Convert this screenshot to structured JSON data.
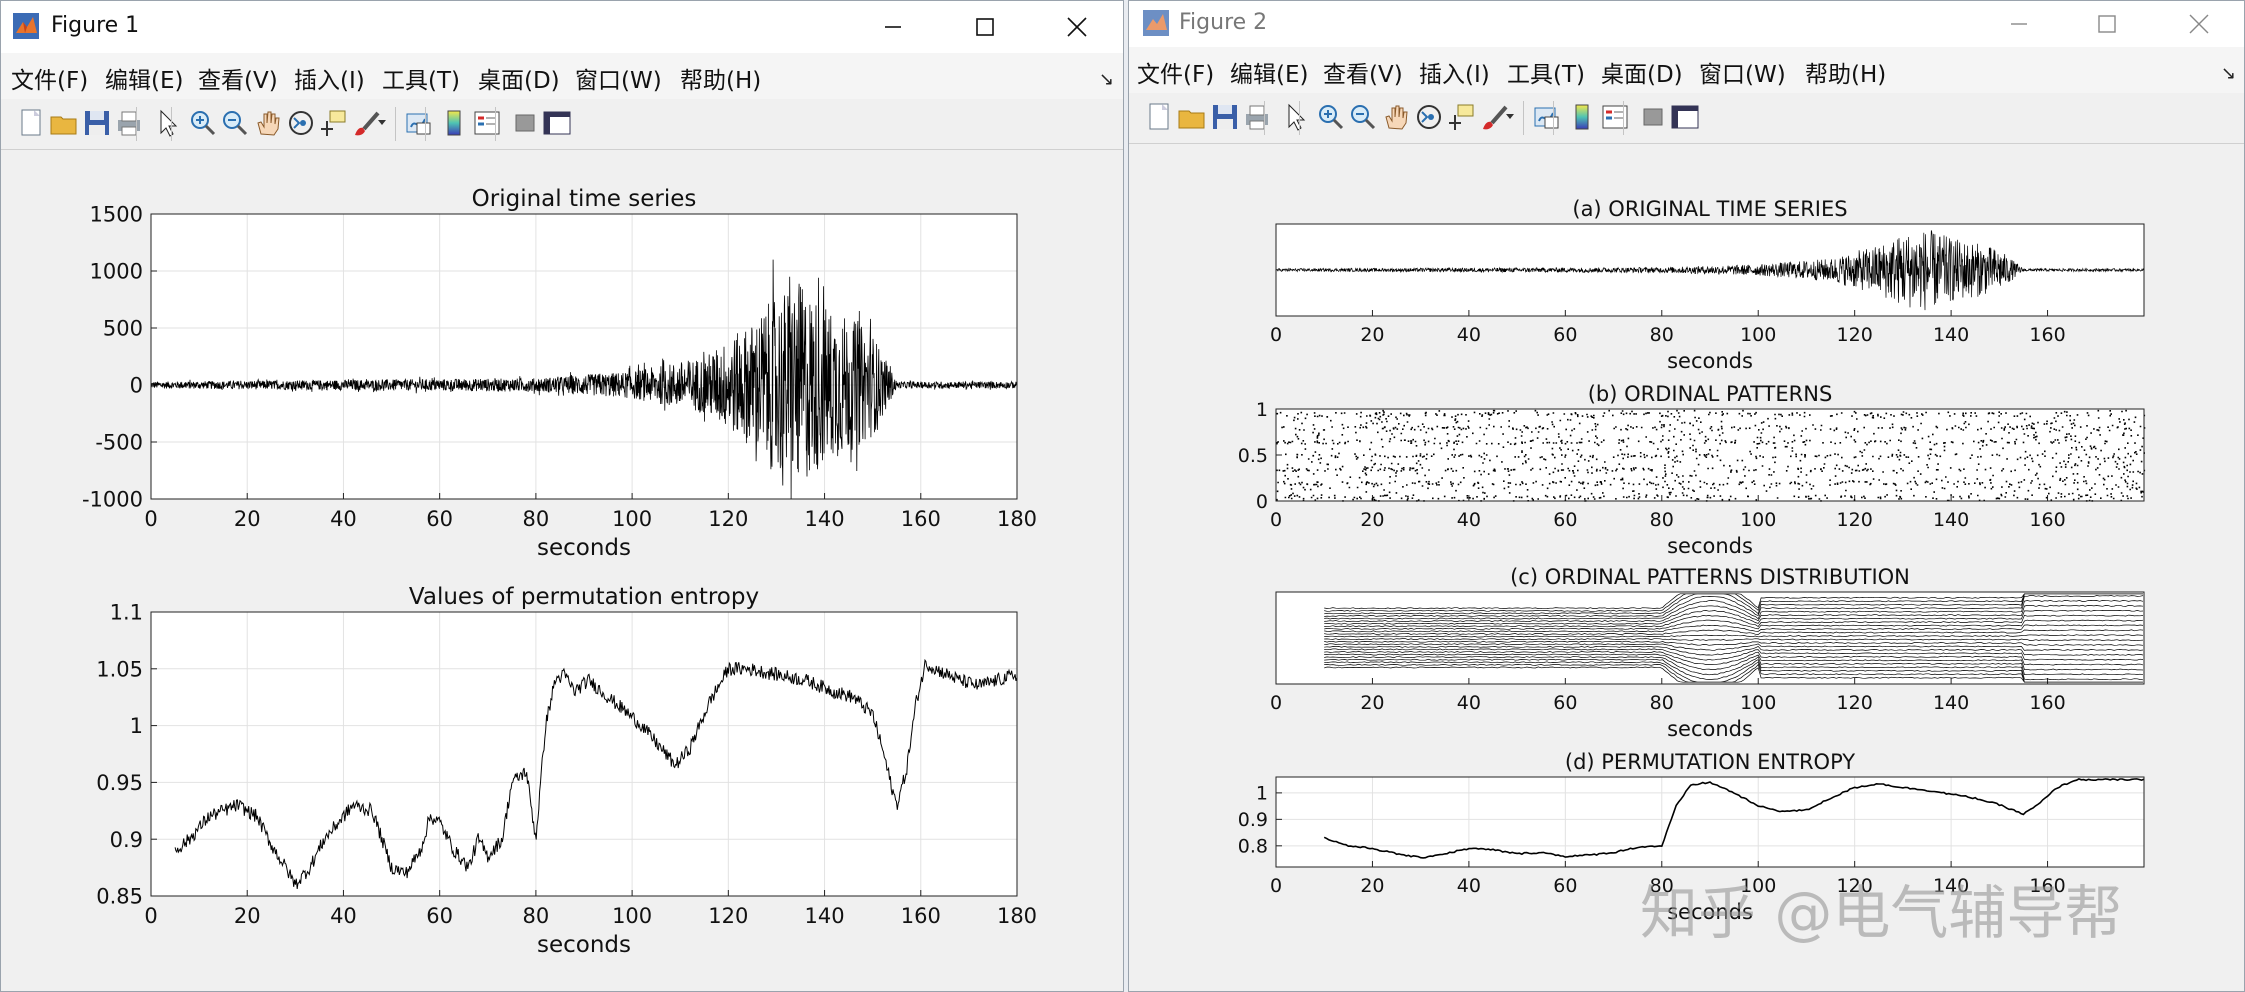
{
  "figure1": {
    "title": "Figure 1",
    "menus": [
      "文件(F)",
      "编辑(E)",
      "查看(V)",
      "插入(I)",
      "工具(T)",
      "桌面(D)",
      "窗口(W)",
      "帮助(H)"
    ],
    "dock_glyph": "↘",
    "minimize_glyph": "─",
    "maximize_glyph": "☐",
    "close_glyph": "✕",
    "axes_top": {
      "title": "Original time series",
      "xlabel": "seconds",
      "xticks": [
        "0",
        "20",
        "40",
        "60",
        "80",
        "100",
        "120",
        "140",
        "160",
        "180"
      ],
      "yticks": [
        "1500",
        "1000",
        "500",
        "0",
        "-500",
        "-1000"
      ]
    },
    "axes_bottom": {
      "title": "Values of permutation entropy",
      "xlabel": "seconds",
      "xticks": [
        "0",
        "20",
        "40",
        "60",
        "80",
        "100",
        "120",
        "140",
        "160",
        "180"
      ],
      "yticks": [
        "1.1",
        "1.05",
        "1",
        "0.95",
        "0.9",
        "0.85"
      ]
    }
  },
  "figure2": {
    "title": "Figure 2",
    "menus": [
      "文件(F)",
      "编辑(E)",
      "查看(V)",
      "插入(I)",
      "工具(T)",
      "桌面(D)",
      "窗口(W)",
      "帮助(H)"
    ],
    "dock_glyph": "↘",
    "minimize_glyph": "─",
    "maximize_glyph": "☐",
    "close_glyph": "✕",
    "panel_a": {
      "title": "(a) ORIGINAL TIME SERIES",
      "xlabel": "seconds",
      "xticks": [
        "0",
        "20",
        "40",
        "60",
        "80",
        "100",
        "120",
        "140",
        "160"
      ]
    },
    "panel_b": {
      "title": "(b) ORDINAL PATTERNS",
      "xlabel": "seconds",
      "xticks": [
        "0",
        "20",
        "40",
        "60",
        "80",
        "100",
        "120",
        "140",
        "160"
      ],
      "yticks": [
        "1",
        "0.5",
        "0"
      ]
    },
    "panel_c": {
      "title": "(c) ORDINAL PATTERNS DISTRIBUTION",
      "xlabel": "seconds",
      "xticks": [
        "0",
        "20",
        "40",
        "60",
        "80",
        "100",
        "120",
        "140",
        "160"
      ]
    },
    "panel_d": {
      "title": "(d) PERMUTATION ENTROPY",
      "xlabel": "seconds",
      "xticks": [
        "0",
        "20",
        "40",
        "60",
        "80",
        "100",
        "120",
        "140",
        "160"
      ],
      "yticks": [
        "1",
        "0.9",
        "0.8"
      ]
    }
  },
  "toolbar_icons": [
    "new-figure-icon",
    "open-file-icon",
    "save-icon",
    "print-icon",
    "pointer-icon",
    "zoom-in-icon",
    "zoom-out-icon",
    "pan-hand-icon",
    "rotate-3d-icon",
    "data-cursor-icon",
    "brush-icon",
    "brush-dropdown-icon",
    "link-plot-icon",
    "colorbar-icon",
    "legend-icon",
    "hide-plot-tools-icon",
    "show-plot-tools-icon"
  ],
  "watermark": "知乎 @电气辅导帮",
  "chart_data": [
    {
      "type": "line",
      "title": "Original time series",
      "xlabel": "seconds",
      "ylabel": "",
      "xlim": [
        0,
        180
      ],
      "ylim": [
        -1000,
        1500
      ],
      "grid": true,
      "series": [
        {
          "x": [
            0,
            80,
            100,
            115,
            125,
            130,
            135,
            140,
            145,
            150,
            155,
            160,
            180
          ],
          "amplitude": [
            30,
            60,
            120,
            250,
            550,
            800,
            900,
            700,
            600,
            450,
            30,
            30,
            30
          ]
        }
      ]
    },
    {
      "type": "line",
      "title": "Values of permutation entropy",
      "xlabel": "seconds",
      "ylabel": "",
      "xlim": [
        0,
        180
      ],
      "ylim": [
        0.85,
        1.1
      ],
      "grid": true,
      "series": [
        {
          "x": [
            5,
            8,
            12,
            18,
            22,
            25,
            28,
            30,
            33,
            36,
            40,
            42,
            46,
            48,
            50,
            53,
            56,
            58,
            60,
            63,
            66,
            68,
            70,
            73,
            75,
            78,
            80,
            82,
            84,
            86,
            88,
            91,
            95,
            98,
            102,
            106,
            109,
            112,
            116,
            120,
            124,
            130,
            136,
            142,
            146,
            150,
            152,
            154,
            155,
            157,
            159,
            161,
            163,
            168,
            172,
            176,
            180
          ],
          "y": [
            0.89,
            0.9,
            0.92,
            0.93,
            0.92,
            0.895,
            0.875,
            0.86,
            0.875,
            0.9,
            0.92,
            0.93,
            0.925,
            0.9,
            0.875,
            0.87,
            0.89,
            0.92,
            0.915,
            0.89,
            0.875,
            0.9,
            0.885,
            0.9,
            0.95,
            0.96,
            0.9,
            1.0,
            1.04,
            1.045,
            1.03,
            1.04,
            1.025,
            1.015,
            1.0,
            0.98,
            0.965,
            0.98,
            1.02,
            1.05,
            1.05,
            1.045,
            1.04,
            1.03,
            1.025,
            1.01,
            0.98,
            0.945,
            0.93,
            0.96,
            1.02,
            1.055,
            1.05,
            1.04,
            1.035,
            1.04,
            1.045
          ]
        }
      ]
    },
    {
      "type": "line",
      "title": "(a) ORIGINAL TIME SERIES",
      "xlabel": "seconds",
      "xlim": [
        0,
        180
      ],
      "grid": false,
      "series": [
        {
          "x": [
            0,
            80,
            100,
            115,
            125,
            130,
            135,
            140,
            145,
            150,
            155,
            160,
            180
          ],
          "amplitude": [
            0.03,
            0.06,
            0.12,
            0.25,
            0.55,
            0.8,
            0.9,
            0.7,
            0.6,
            0.45,
            0.03,
            0.03,
            0.03
          ]
        }
      ]
    },
    {
      "type": "scatter",
      "title": "(b) ORDINAL PATTERNS",
      "xlabel": "seconds",
      "xlim": [
        0,
        180
      ],
      "ylim": [
        0,
        1
      ],
      "grid": false
    },
    {
      "type": "line",
      "title": "(c) ORDINAL PATTERNS DISTRIBUTION",
      "xlabel": "seconds",
      "xlim": [
        0,
        180
      ],
      "grid": false
    },
    {
      "type": "line",
      "title": "(d) PERMUTATION ENTROPY",
      "xlabel": "seconds",
      "xlim": [
        0,
        180
      ],
      "ylim": [
        0.72,
        1.06
      ],
      "grid": true,
      "series": [
        {
          "x": [
            10,
            15,
            20,
            25,
            30,
            35,
            40,
            45,
            50,
            55,
            60,
            65,
            70,
            75,
            80,
            83,
            86,
            90,
            95,
            100,
            105,
            110,
            115,
            120,
            125,
            130,
            135,
            140,
            145,
            150,
            155,
            158,
            162,
            166,
            170,
            175,
            180
          ],
          "y": [
            0.83,
            0.8,
            0.79,
            0.77,
            0.755,
            0.77,
            0.79,
            0.785,
            0.77,
            0.775,
            0.76,
            0.765,
            0.775,
            0.795,
            0.8,
            0.95,
            1.03,
            1.04,
            1.0,
            0.95,
            0.93,
            0.935,
            0.98,
            1.02,
            1.035,
            1.02,
            1.01,
            0.995,
            0.98,
            0.955,
            0.92,
            0.955,
            1.02,
            1.05,
            1.05,
            1.05,
            1.05
          ]
        }
      ]
    }
  ]
}
